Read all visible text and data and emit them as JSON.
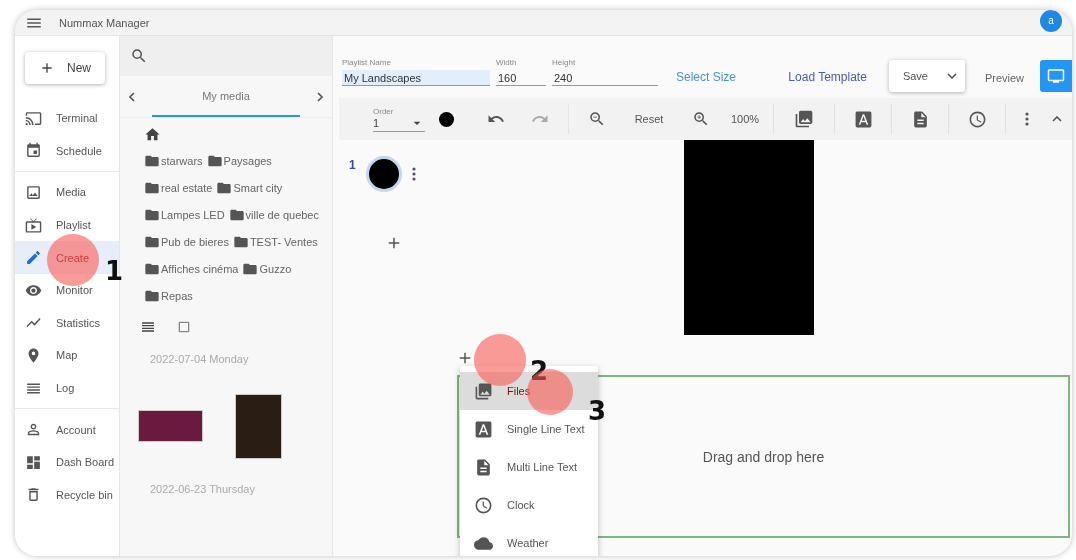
{
  "app": {
    "title": "Nummax Manager",
    "avatar": "a"
  },
  "sidebar": {
    "new_button": "New",
    "groups": [
      [
        {
          "label": "Terminal",
          "selected": false
        },
        {
          "label": "Schedule",
          "selected": false
        }
      ],
      [
        {
          "label": "Media",
          "selected": false
        },
        {
          "label": "Playlist",
          "selected": false
        },
        {
          "label": "Create",
          "selected": true
        },
        {
          "label": "Monitor",
          "selected": false
        },
        {
          "label": "Statistics",
          "selected": false
        },
        {
          "label": "Map",
          "selected": false
        },
        {
          "label": "Log",
          "selected": false
        }
      ],
      [
        {
          "label": "Account",
          "selected": false
        },
        {
          "label": "Dash Board",
          "selected": false
        },
        {
          "label": "Recycle bin",
          "selected": false
        }
      ]
    ]
  },
  "media": {
    "tabs": [
      {
        "label": "My media",
        "selected": true
      }
    ],
    "folders": [
      [
        "starwars",
        "Paysages"
      ],
      [
        "real estate",
        "Smart city"
      ],
      [
        "Lampes LED",
        "ville de quebec"
      ],
      [
        "Pub de bieres",
        "TEST- Ventes"
      ],
      [
        "Affiches cinéma",
        "Guzzo"
      ],
      [
        "Repas"
      ]
    ],
    "view_modes": [
      {
        "selected": true
      },
      {
        "selected": false
      }
    ],
    "dates": [
      "2022-07-04 Monday",
      "2022-06-23 Thursday"
    ]
  },
  "editor": {
    "fields": [
      {
        "label": "Playlist Name",
        "value": "My Landscapes",
        "focused": true
      },
      {
        "label": "Width",
        "value": "160",
        "focused": false
      },
      {
        "label": "Height",
        "value": "240",
        "focused": false
      }
    ],
    "select_size": "Select Size",
    "load_template": "Load Template",
    "save": "Save",
    "preview": "Preview",
    "toolbar": {
      "order_label": "Order",
      "order_value": "1",
      "reset": "Reset",
      "zoom": "100%"
    },
    "tracks": [
      {
        "index": "1"
      }
    ],
    "dropzone": "Drag and drop here",
    "add_menu": [
      {
        "label": "Files",
        "selected": true
      },
      {
        "label": "Single Line Text",
        "selected": false
      },
      {
        "label": "Multi Line Text",
        "selected": false
      },
      {
        "label": "Clock",
        "selected": false
      },
      {
        "label": "Weather",
        "selected": false
      }
    ]
  },
  "annotations": [
    {
      "number": "1"
    },
    {
      "number": "2"
    },
    {
      "number": "3"
    }
  ]
}
